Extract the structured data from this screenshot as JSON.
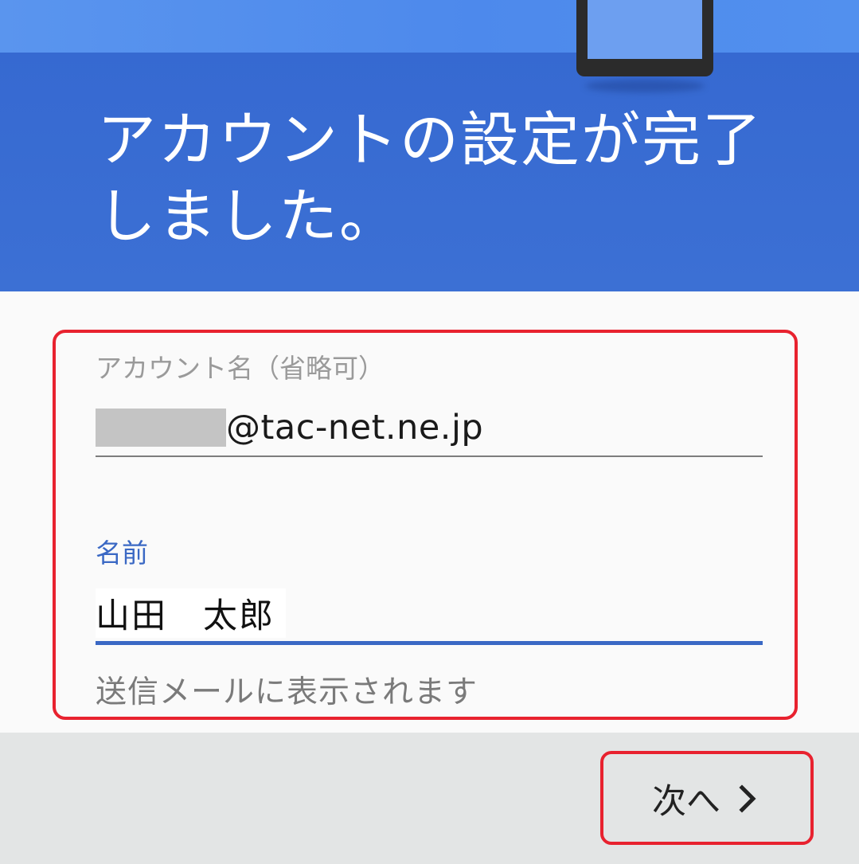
{
  "header": {
    "title_line1": "アカウントの設定が完了",
    "title_line2": "しました。"
  },
  "account_field": {
    "label": "アカウント名（省略可）",
    "value_suffix": "@tac-net.ne.jp"
  },
  "name_field": {
    "label": "名前",
    "value": "山田　太郎",
    "helper": "送信メールに表示されます"
  },
  "footer": {
    "next_label": "次へ",
    "next_icon": "chevron-right-icon"
  },
  "colors": {
    "header_blue": "#3b6fd3",
    "accent_blue": "#3a68c4",
    "highlight_red": "#e8222f"
  }
}
